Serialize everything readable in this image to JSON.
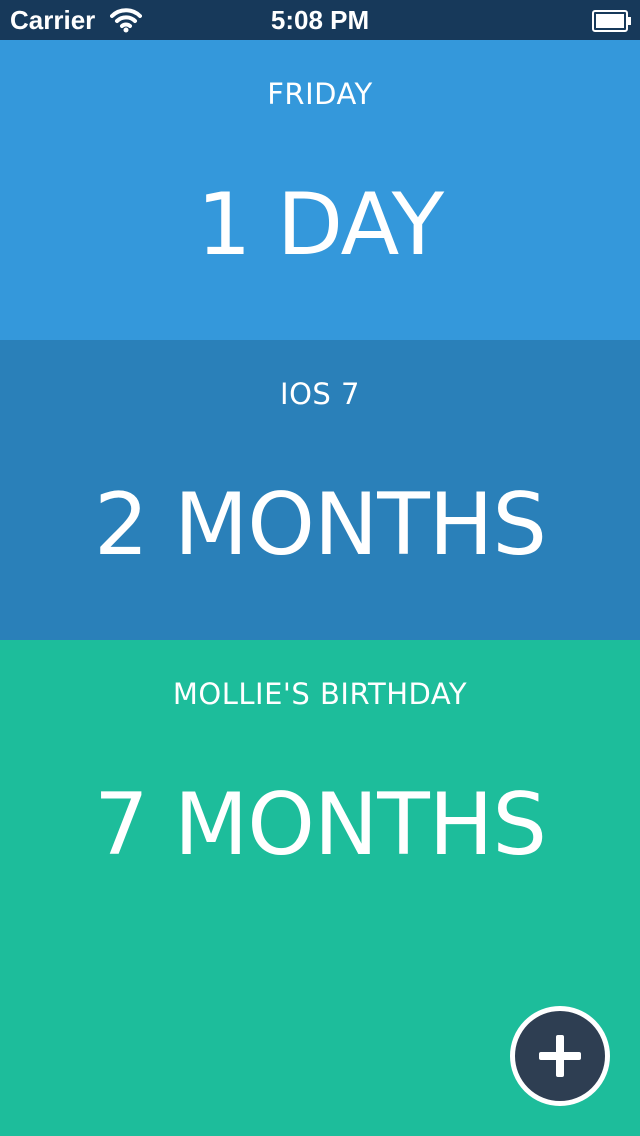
{
  "status_bar": {
    "carrier": "Carrier",
    "time": "5:08 PM",
    "wifi_icon": "wifi-icon",
    "battery_icon": "battery-icon"
  },
  "countdowns": [
    {
      "name": "FRIDAY",
      "remaining": "1 DAY",
      "color": "#3498db"
    },
    {
      "name": "IOS 7",
      "remaining": "2 MONTHS",
      "color": "#2a80b9"
    },
    {
      "name": "MOLLIE'S BIRTHDAY",
      "remaining": "7 MONTHS",
      "color": "#1dbd9b"
    }
  ],
  "add_button": {
    "icon": "plus-icon",
    "color": "#2e3e52"
  }
}
